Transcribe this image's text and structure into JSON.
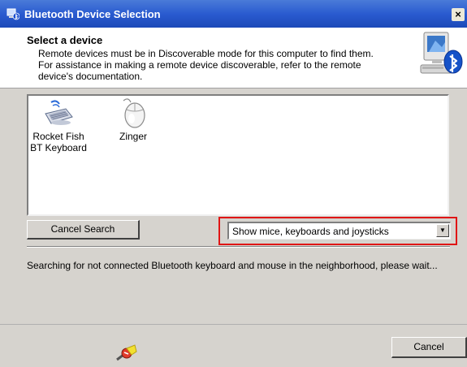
{
  "window": {
    "title": "Bluetooth Device Selection",
    "close_label": "×"
  },
  "header": {
    "title": "Select a device",
    "description": "Remote devices must be in Discoverable mode for this computer to find them.\nFor assistance in making a remote device discoverable, refer to the remote\ndevice's documentation.",
    "icon": "bluetooth-computer-icon"
  },
  "devices": [
    {
      "label": "Rocket Fish\nBT Keyboard",
      "icon": "keyboard-icon"
    },
    {
      "label": "Zinger",
      "icon": "mouse-icon"
    }
  ],
  "buttons": {
    "cancel_search": "Cancel Search",
    "cancel": "Cancel"
  },
  "filter": {
    "selected": "Show mice, keyboards and joysticks"
  },
  "status_text": "Searching for not connected Bluetooth keyboard and mouse in the neighborhood, please wait...",
  "colors": {
    "title_bar": "#2a5bd0",
    "highlight": "#e01515",
    "dialog_bg": "#d6d3ce"
  }
}
